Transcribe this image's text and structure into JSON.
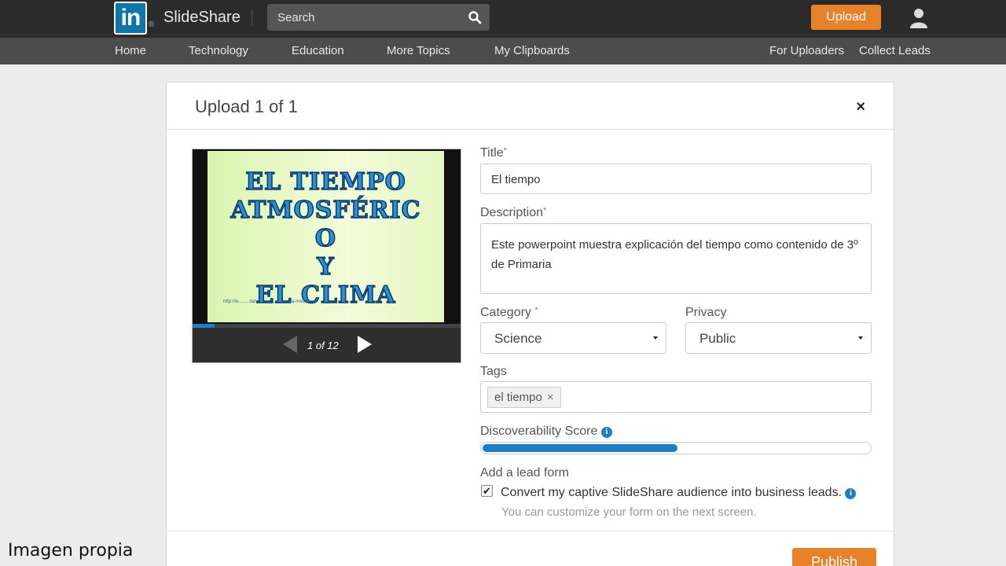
{
  "header": {
    "logo_text": "in",
    "logo_reg": "®",
    "brand": "SlideShare",
    "search_placeholder": "Search",
    "upload_label": "Upload"
  },
  "nav": {
    "left": [
      "Home",
      "Technology",
      "Education",
      "More Topics",
      "My Clipboards"
    ],
    "right": [
      "For Uploaders",
      "Collect Leads"
    ]
  },
  "modal": {
    "title": "Upload 1 of 1",
    "close": "×",
    "preview": {
      "slide_lines": [
        "EL TIEMPO",
        "ATMOSFÉRIC",
        "O",
        "Y",
        "EL CLIMA"
      ],
      "slide_url": "http://w.........ta/v.......................rea-mediterra",
      "page_indicator": "1 of 12",
      "progress": 0.083
    },
    "form": {
      "title_label": "Title",
      "title_value": "El tiempo",
      "description_label": "Description",
      "description_value": "Este powerpoint muestra explicación del tiempo como contenido de 3º de Primaria",
      "category_label": "Category",
      "category_value": "Science",
      "privacy_label": "Privacy",
      "privacy_value": "Public",
      "tags_label": "Tags",
      "tags": [
        "el tiempo"
      ],
      "tag_remove": "×",
      "score_label": "Discoverability Score",
      "score_value": 0.5,
      "lead_label": "Add a lead form",
      "lead_checkbox_checked": true,
      "lead_checkbox_label": "Convert my captive SlideShare audience into business leads.",
      "lead_hint": "You can customize your form on the next screen.",
      "required_mark": "*",
      "info_symbol": "i"
    },
    "publish_label": "Publish"
  },
  "caption": "Imagen propia",
  "colors": {
    "topbar": "#2b2b2b",
    "navbar": "#4c4c4c",
    "accent": "#e8822a",
    "linkedin_blue": "#0e76a8",
    "progress_blue": "#1f7fc5"
  }
}
